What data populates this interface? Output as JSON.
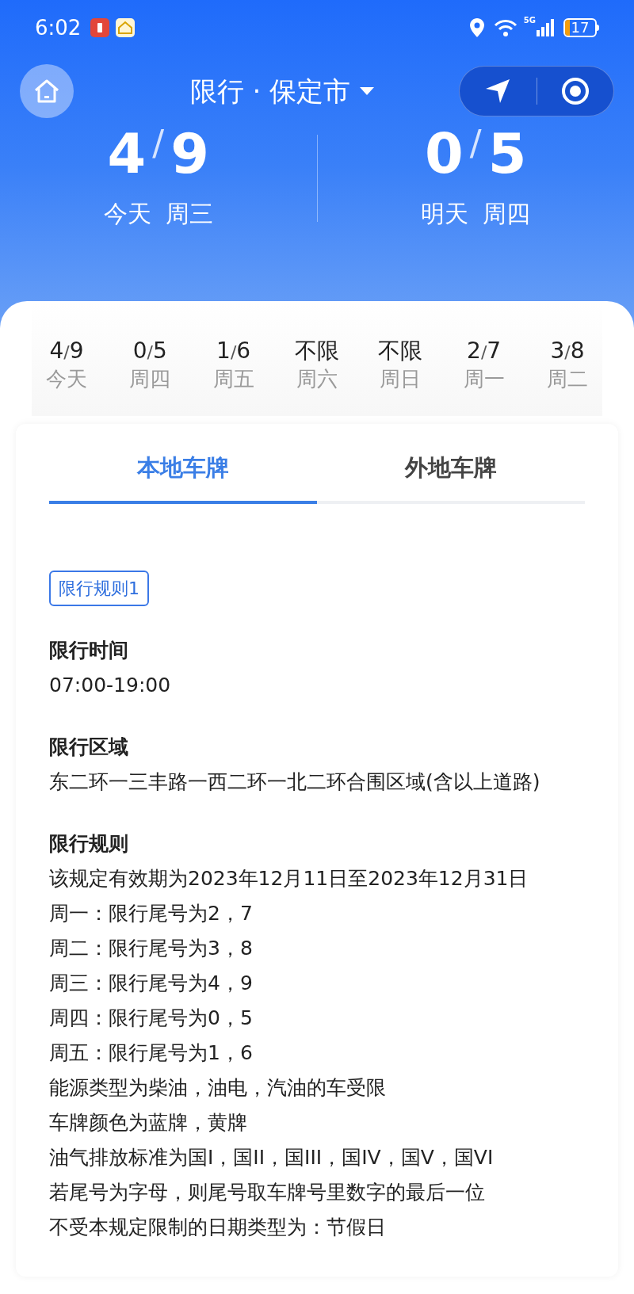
{
  "status_bar": {
    "time": "6:02",
    "network": "5G",
    "battery": "17"
  },
  "header": {
    "title": "限行 · 保定市"
  },
  "summary": [
    {
      "numbers": "4/9",
      "day": "今天",
      "weekday": "周三"
    },
    {
      "numbers": "0/5",
      "day": "明天",
      "weekday": "周四"
    }
  ],
  "week": [
    {
      "numbers": "4/9",
      "day": "今天"
    },
    {
      "numbers": "0/5",
      "day": "周四"
    },
    {
      "numbers": "1/6",
      "day": "周五"
    },
    {
      "numbers": "不限",
      "day": "周六"
    },
    {
      "numbers": "不限",
      "day": "周日"
    },
    {
      "numbers": "2/7",
      "day": "周一"
    },
    {
      "numbers": "3/8",
      "day": "周二"
    }
  ],
  "tabs": [
    {
      "label": "本地车牌",
      "selected": true
    },
    {
      "label": "外地车牌",
      "selected": false
    }
  ],
  "rule_tag": "限行规则1",
  "sections": [
    {
      "heading": "限行时间",
      "lines": [
        "07:00-19:00"
      ]
    },
    {
      "heading": "限行区域",
      "lines": [
        "东二环一三丰路一西二环一北二环合围区域(含以上道路)"
      ]
    },
    {
      "heading": "限行规则",
      "lines": [
        "该规定有效期为2023年12月11日至2023年12月31日",
        "周一：限行尾号为2，7",
        "周二：限行尾号为3，8",
        "周三：限行尾号为4，9",
        "周四：限行尾号为0，5",
        "周五：限行尾号为1，6",
        "能源类型为柴油，油电，汽油的车受限",
        "车牌颜色为蓝牌，黄牌",
        "油气排放标准为国I，国II，国III，国IV，国V，国VI",
        "若尾号为字母，则尾号取车牌号里数字的最后一位",
        "不受本规定限制的日期类型为：节假日"
      ]
    }
  ]
}
